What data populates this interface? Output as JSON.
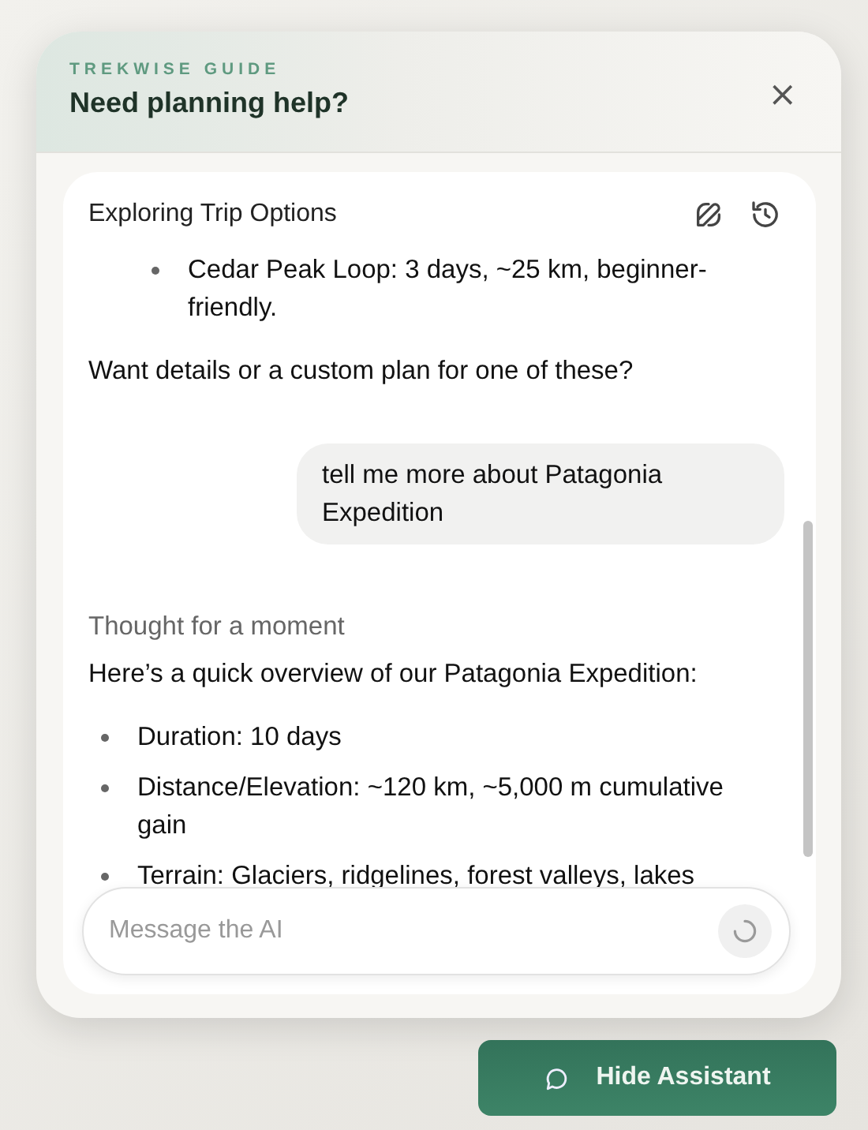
{
  "header": {
    "eyebrow": "TREKWISE GUIDE",
    "title": "Need planning help?",
    "close": "×"
  },
  "chat": {
    "title": "Exploring Trip Options",
    "messages": [
      {
        "kind": "assistant",
        "blocks": [
          {
            "kind": "nested_list",
            "items": [
              "Cedar Peak Loop: 3 days, ~25 km, beginner-friendly."
            ]
          },
          {
            "kind": "paragraph",
            "text": "Want details or a custom plan for one of these?"
          }
        ]
      },
      {
        "kind": "user",
        "text": "tell me more about Patagonia Expedition"
      },
      {
        "kind": "thought",
        "text": "Thought for a moment"
      },
      {
        "kind": "assistant",
        "blocks": [
          {
            "kind": "paragraph",
            "text": "Here’s a quick overview of our Patagonia Expedition:"
          },
          {
            "kind": "list",
            "items": [
              "Duration: 10 days",
              "Distance/Elevation: ~120 km, ~5,000 m cumulative gain",
              "Terrain: Glaciers, ridgelines, forest valleys, lakes"
            ]
          }
        ]
      }
    ],
    "input": {
      "placeholder": "Message the AI"
    }
  },
  "toggle_button": {
    "label": "Hide Assistant"
  }
}
